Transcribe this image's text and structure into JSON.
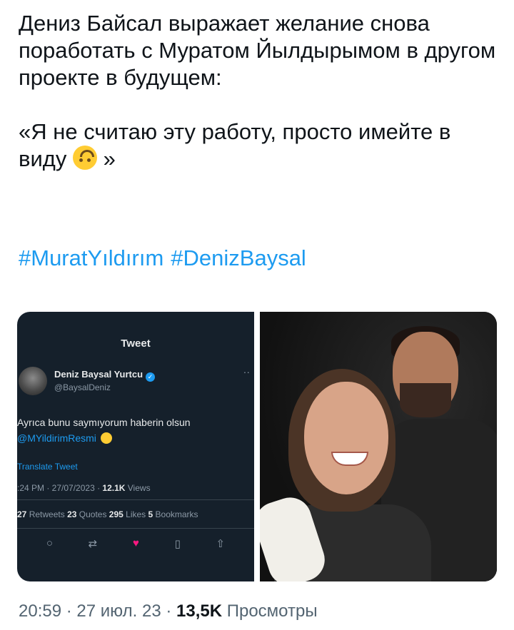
{
  "tweet": {
    "text_line1": "Дениз Байсал выражает желание снова поработать с Муратом Йылдырымом в другом проекте в будущем:",
    "quote_open": "«Я не считаю эту работу, просто имейте в виду ",
    "quote_close": " »",
    "emoji_name": "upside-down-face",
    "hashtags": [
      "#MuratYıldırım",
      "#DenizBaysal"
    ]
  },
  "embedded_tweet": {
    "title": "Tweet",
    "author_name": "Deniz Baysal Yurtcu",
    "author_handle": "@BaysalDeniz",
    "more": "··",
    "body_line1": "Ayrıca bunu saymıyorum haberin olsun",
    "mention": "@MYildirimResmi",
    "translate": "Translate Tweet",
    "time_date": ":24 PM · 27/07/2023 · ",
    "views_count": "12.1K",
    "views_label": " Views",
    "retweets_count": "27",
    "retweets_label": " Retweets ",
    "quotes_count": "23",
    "quotes_label": " Quotes ",
    "likes_count": "295",
    "likes_label": " Likes ",
    "bookmarks_count": "5",
    "bookmarks_label": " Bookmarks",
    "actions": [
      "reply-icon",
      "retweet-icon",
      "like-icon",
      "bookmark-icon",
      "share-icon"
    ]
  },
  "footer": {
    "time": "20:59 · 27 июл. 23 · ",
    "views_count": "13,5K",
    "views_label": " Просмотры"
  },
  "colors": {
    "link": "#1d9bf0",
    "text": "#0f1419",
    "muted": "#536471",
    "embed_bg": "#15202b",
    "like": "#f91880"
  }
}
